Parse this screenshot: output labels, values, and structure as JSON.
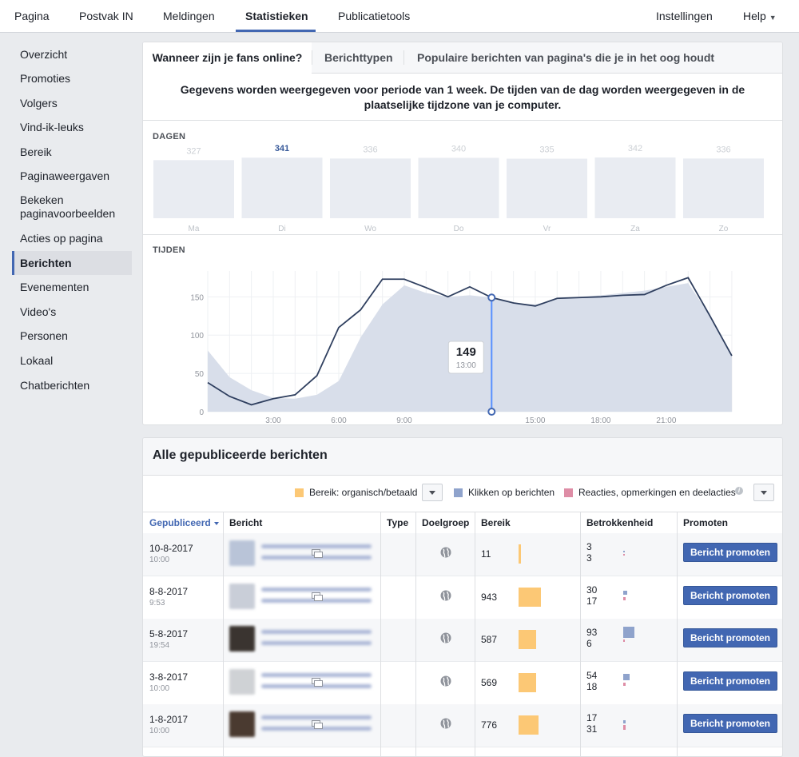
{
  "topnav": {
    "tabs": [
      "Pagina",
      "Postvak IN",
      "Meldingen",
      "Statistieken",
      "Publicatietools"
    ],
    "active": "Statistieken",
    "settings": "Instellingen",
    "help": "Help"
  },
  "sidebar": {
    "items": [
      "Overzicht",
      "Promoties",
      "Volgers",
      "Vind-ik-leuks",
      "Bereik",
      "Paginaweergaven",
      "Bekeken paginavoorbeelden",
      "Acties op pagina",
      "Berichten",
      "Evenementen",
      "Video's",
      "Personen",
      "Lokaal",
      "Chatberichten"
    ],
    "active": "Berichten"
  },
  "subtabs": [
    "Wanneer zijn je fans online?",
    "Berichttypen",
    "Populaire berichten van pagina's die je in het oog houdt"
  ],
  "notice": "Gegevens worden weergegeven voor periode van 1 week. De tijden van de dag worden weergegeven in de plaatselijke tijdzone van je computer.",
  "days_section": {
    "label": "DAGEN",
    "days": [
      {
        "day": "Ma",
        "value": 327
      },
      {
        "day": "Di",
        "value": 341
      },
      {
        "day": "Wo",
        "value": 336
      },
      {
        "day": "Do",
        "value": 340
      },
      {
        "day": "Vr",
        "value": 335
      },
      {
        "day": "Za",
        "value": 342
      },
      {
        "day": "Zo",
        "value": 336
      }
    ],
    "highlighted": "Di"
  },
  "chart_data": {
    "type": "area",
    "title": "TIJDEN",
    "x": [
      0,
      1,
      2,
      3,
      4,
      5,
      6,
      7,
      8,
      9,
      10,
      11,
      12,
      13,
      14,
      15,
      16,
      17,
      18,
      19,
      20,
      21,
      22,
      23,
      24
    ],
    "x_tick_labels": [
      "3:00",
      "6:00",
      "9:00",
      "15:00",
      "18:00",
      "21:00"
    ],
    "x_tick_positions": [
      3,
      6,
      9,
      15,
      18,
      21
    ],
    "ylim": [
      0,
      190
    ],
    "y_ticks": [
      0,
      50,
      100,
      150
    ],
    "series": [
      {
        "name": "",
        "style": "line",
        "values": [
          38,
          20,
          9,
          17,
          22,
          47,
          110,
          133,
          173,
          173,
          162,
          150,
          163,
          149,
          142,
          138,
          148,
          149,
          150,
          152,
          153,
          165,
          175,
          125,
          73
        ]
      },
      {
        "name": "",
        "style": "area",
        "values": [
          80,
          45,
          28,
          18,
          17,
          22,
          40,
          97,
          140,
          165,
          155,
          150,
          152,
          149,
          142,
          140,
          147,
          150,
          152,
          155,
          158,
          163,
          168,
          125,
          73
        ]
      }
    ],
    "tooltip": {
      "value": "149",
      "time": "13:00",
      "x": 13
    }
  },
  "table": {
    "title": "Alle gepubliceerde berichten",
    "legend": [
      {
        "label": "Bereik: organisch/betaald",
        "color": "#fcc875"
      },
      {
        "label": "Klikken op berichten",
        "color": "#8fa3cc"
      },
      {
        "label": "Reacties, opmerkingen en deelacties",
        "color": "#de8da6"
      }
    ],
    "columns": [
      "Gepubliceerd",
      "Bericht",
      "Type",
      "Doelgroep",
      "Bereik",
      "Betrokkenheid",
      "Promoten"
    ],
    "promote_label": "Bericht promoten",
    "rows": [
      {
        "date": "10-8-2017",
        "time": "10:00",
        "reach": "11",
        "clicks": "3",
        "reactions": "3",
        "has_type": true
      },
      {
        "date": "8-8-2017",
        "time": "9:53",
        "reach": "943",
        "clicks": "30",
        "reactions": "17",
        "has_type": true
      },
      {
        "date": "5-8-2017",
        "time": "19:54",
        "reach": "587",
        "clicks": "93",
        "reactions": "6",
        "has_type": false
      },
      {
        "date": "3-8-2017",
        "time": "10:00",
        "reach": "569",
        "clicks": "54",
        "reactions": "18",
        "has_type": true
      },
      {
        "date": "1-8-2017",
        "time": "10:00",
        "reach": "776",
        "clicks": "17",
        "reactions": "31",
        "has_type": true
      }
    ]
  },
  "colors": {
    "accent": "#4267b2",
    "area_fill": "#d8deea",
    "line": "#2f3f5f",
    "day_bar": "#e9ecf2"
  }
}
